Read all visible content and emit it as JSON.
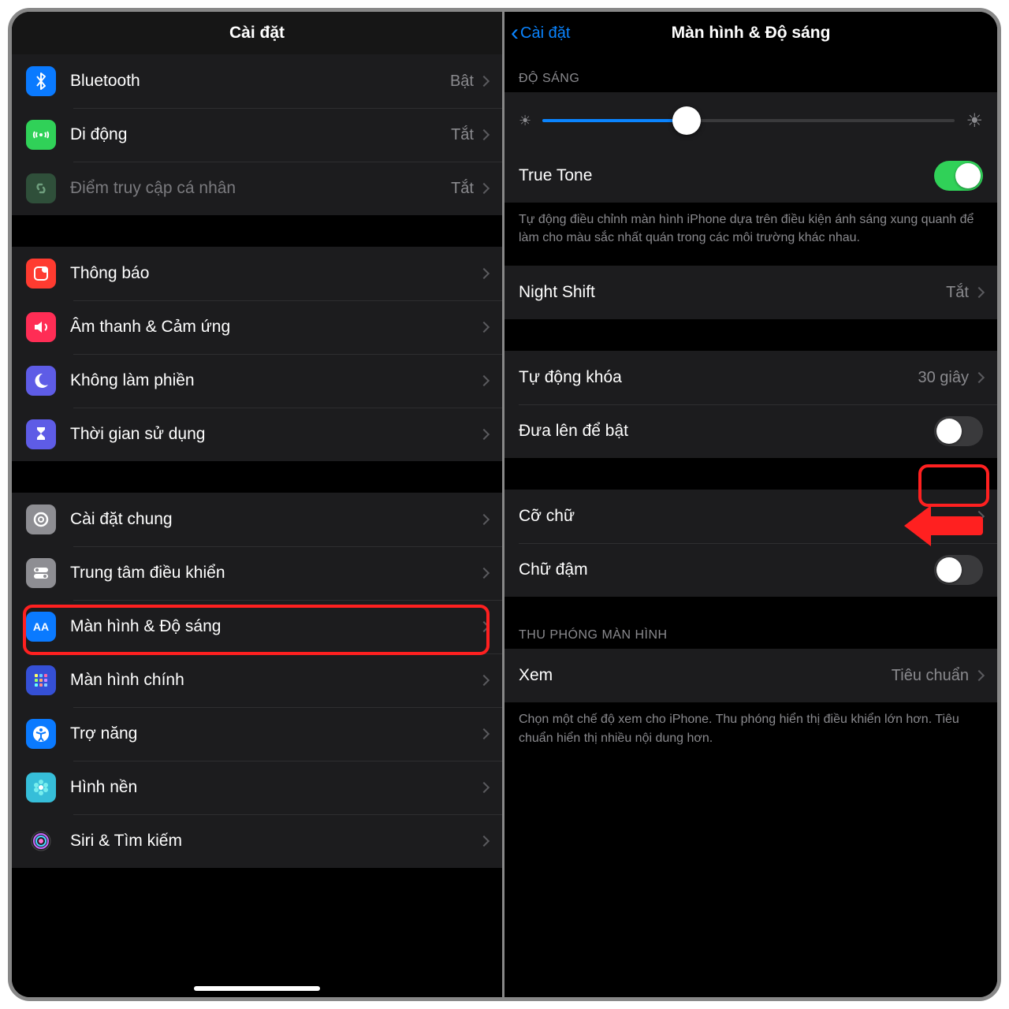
{
  "left": {
    "title": "Cài đặt",
    "group1": [
      {
        "label": "Bluetooth",
        "value": "Bật",
        "icon": "bluetooth",
        "bg": "#0a7aff"
      },
      {
        "label": "Di động",
        "value": "Tắt",
        "icon": "antenna",
        "bg": "#30d158"
      },
      {
        "label": "Điểm truy cập cá nhân",
        "value": "Tắt",
        "icon": "link",
        "bg": "#2f4f3a",
        "dim": true
      }
    ],
    "group2": [
      {
        "label": "Thông báo",
        "icon": "notif",
        "bg": "#ff3b30"
      },
      {
        "label": "Âm thanh & Cảm ứng",
        "icon": "sound",
        "bg": "#ff2d55"
      },
      {
        "label": "Không làm phiền",
        "icon": "moon",
        "bg": "#5e5ce6"
      },
      {
        "label": "Thời gian sử dụng",
        "icon": "hourglass",
        "bg": "#5e5ce6"
      }
    ],
    "group3": [
      {
        "label": "Cài đặt chung",
        "icon": "gear",
        "bg": "#8e8e93"
      },
      {
        "label": "Trung tâm điều khiển",
        "icon": "toggles",
        "bg": "#8e8e93"
      },
      {
        "label": "Màn hình & Độ sáng",
        "icon": "aa",
        "bg": "#0a7aff",
        "highlight": true
      },
      {
        "label": "Màn hình chính",
        "icon": "grid",
        "bg": "#3550d6"
      },
      {
        "label": "Trợ năng",
        "icon": "access",
        "bg": "#0a7aff"
      },
      {
        "label": "Hình nền",
        "icon": "flower",
        "bg": "#36bed9"
      },
      {
        "label": "Siri & Tìm kiếm",
        "icon": "siri",
        "bg": "#1c1c1e"
      }
    ]
  },
  "right": {
    "back": "Cài đặt",
    "title": "Màn hình & Độ sáng",
    "section_brightness": "ĐỘ SÁNG",
    "brightness_percent": 35,
    "truetone": {
      "label": "True Tone",
      "on": true
    },
    "truetone_desc": "Tự động điều chỉnh màn hình iPhone dựa trên điều kiện ánh sáng xung quanh để làm cho màu sắc nhất quán trong các môi trường khác nhau.",
    "nightshift": {
      "label": "Night Shift",
      "value": "Tắt"
    },
    "autolock": {
      "label": "Tự động khóa",
      "value": "30 giây"
    },
    "raise": {
      "label": "Đưa lên để bật",
      "on": false
    },
    "textsize": {
      "label": "Cỡ chữ"
    },
    "bold": {
      "label": "Chữ đậm",
      "on": false
    },
    "section_zoom": "THU PHÓNG MÀN HÌNH",
    "view": {
      "label": "Xem",
      "value": "Tiêu chuẩn"
    },
    "view_desc": "Chọn một chế độ xem cho iPhone. Thu phóng hiển thị điều khiển lớn hơn. Tiêu chuẩn hiển thị nhiều nội dung hơn."
  }
}
